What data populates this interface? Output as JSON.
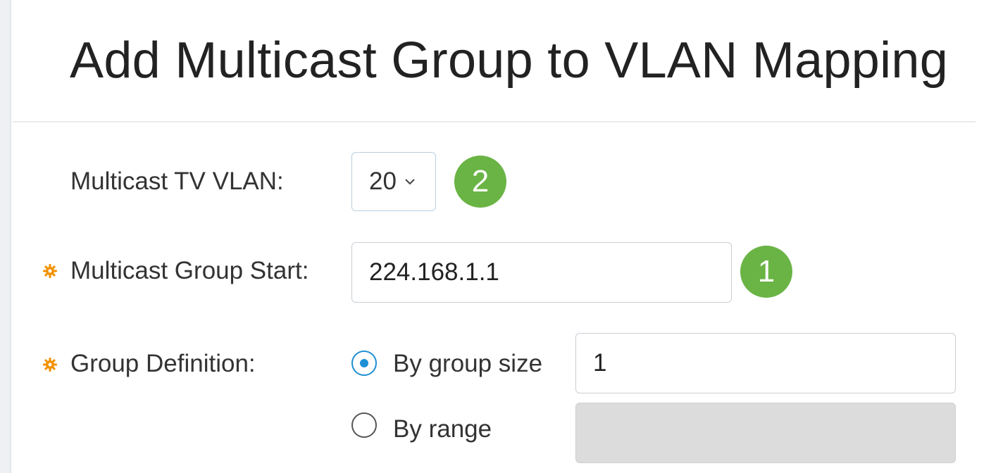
{
  "page": {
    "title": "Add Multicast Group to VLAN Mapping"
  },
  "form": {
    "tv_vlan": {
      "label": "Multicast TV VLAN:",
      "value": "20",
      "badge": "2"
    },
    "group_start": {
      "label": "Multicast Group Start:",
      "value": "224.168.1.1",
      "badge": "1"
    },
    "group_definition": {
      "label": "Group Definition:",
      "options": [
        {
          "label": "By group size",
          "selected": true,
          "value": "1"
        },
        {
          "label": "By range",
          "selected": false,
          "value": ""
        }
      ]
    }
  },
  "colors": {
    "badge": "#6ab445",
    "radio_selected": "#1f8fd4",
    "required_icon": "#f29100"
  }
}
